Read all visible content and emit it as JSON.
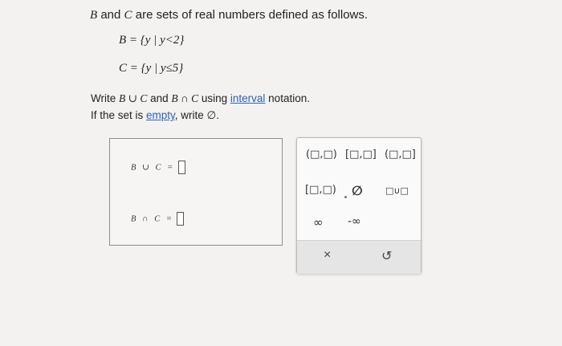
{
  "problem": {
    "intro_var1": "B",
    "intro_and": " and ",
    "intro_var2": "C",
    "intro_rest": " are sets of real numbers defined as follows.",
    "def_b": "B = {y | y<2}",
    "def_c": "C = {y | y≤5}",
    "prompt_line1_pre": "Write ",
    "prompt_union": "B ∪ C",
    "prompt_and": " and ",
    "prompt_intersection": "B ∩ C",
    "prompt_using": " using ",
    "prompt_link": "interval",
    "prompt_line1_post": " notation.",
    "prompt_line2_pre": "If the set is ",
    "prompt_line2_link": "empty",
    "prompt_line2_post": ", write ∅."
  },
  "answers": {
    "union_label": "B ∪ C =",
    "intersection_label": "B ∩ C ="
  },
  "palette": {
    "open_open": "(□,□)",
    "closed_closed": "[□,□]",
    "open_closed": "(□,□]",
    "closed_open": "[□,□)",
    "empty_set": "∅",
    "union": "□∪□",
    "infinity": "∞",
    "neg_infinity": "-∞",
    "clear": "×",
    "undo": "↺"
  }
}
